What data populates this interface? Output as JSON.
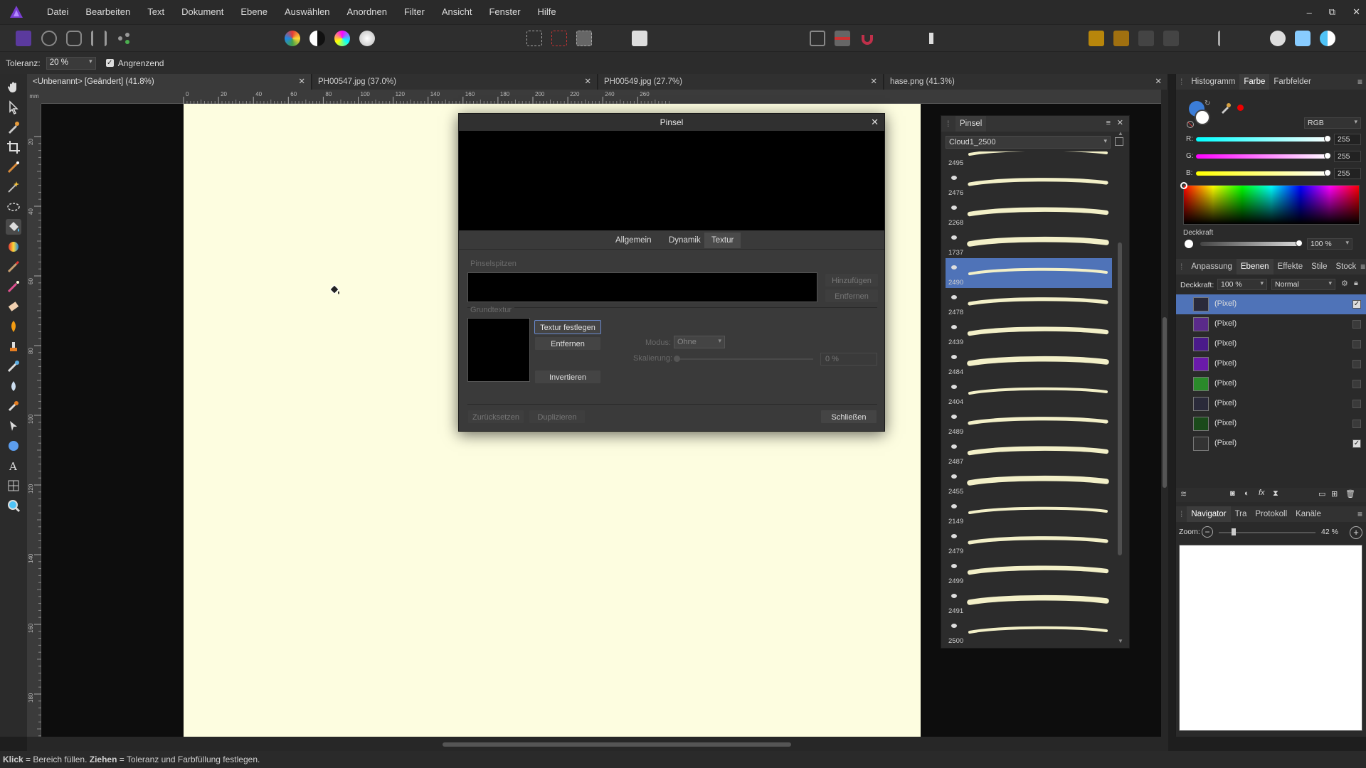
{
  "menubar": {
    "items": [
      "Datei",
      "Bearbeiten",
      "Text",
      "Dokument",
      "Ebene",
      "Auswählen",
      "Anordnen",
      "Filter",
      "Ansicht",
      "Fenster",
      "Hilfe"
    ]
  },
  "window_controls": {
    "minimize": "–",
    "restore": "⧉",
    "close": "✕"
  },
  "context_bar": {
    "tolerance_label": "Toleranz:",
    "tolerance_value": "20 %",
    "contiguous_label": "Angrenzend",
    "contiguous_checked": true
  },
  "document_tabs": [
    {
      "label": "<Unbenannt> [Geändert] (41.8%)",
      "active": true
    },
    {
      "label": "PH00547.jpg (37.0%)",
      "active": false
    },
    {
      "label": "PH00549.jpg (27.7%)",
      "active": false
    },
    {
      "label": "hase.png (41.3%)",
      "active": false
    }
  ],
  "ruler": {
    "unit": "mm",
    "h_ticks": [
      "0",
      "20",
      "40",
      "60",
      "80",
      "100",
      "120",
      "140",
      "160",
      "180",
      "200",
      "220",
      "240",
      "260"
    ],
    "v_ticks": [
      "20",
      "40",
      "60",
      "80",
      "100",
      "120",
      "140",
      "160",
      "180"
    ]
  },
  "dialog": {
    "title": "Pinsel",
    "tabs": [
      "Allgemein",
      "Dynamik",
      "Textur"
    ],
    "active_tab": "Textur",
    "section1_label": "Pinselspitzen",
    "section2_label": "Grundtextur",
    "btn_add": "Hinzufügen",
    "btn_remove_tip": "Entfernen",
    "btn_set_texture": "Textur festlegen",
    "btn_remove_texture": "Entfernen",
    "btn_invert": "Invertieren",
    "mode_label": "Modus:",
    "mode_value": "Ohne",
    "scale_label": "Skalierung:",
    "scale_value": "0 %",
    "btn_reset": "Zurücksetzen",
    "btn_duplicate": "Duplizieren",
    "btn_close": "Schließen"
  },
  "brush_panel": {
    "title": "Pinsel",
    "category": "Cloud1_2500",
    "brushes": [
      "2495",
      "2476",
      "2268",
      "1737",
      "2490",
      "2478",
      "2439",
      "2484",
      "2404",
      "2489",
      "2487",
      "2455",
      "2149",
      "2479",
      "2499",
      "2491",
      "2500"
    ],
    "selected": "2490"
  },
  "color_panel": {
    "tabs": [
      "Histogramm",
      "Farbe",
      "Farbfelder"
    ],
    "active_tab": "Farbe",
    "mode": "RGB",
    "r_label": "R:",
    "r_value": "255",
    "g_label": "G:",
    "g_value": "255",
    "b_label": "B:",
    "b_value": "255",
    "opacity_label": "Deckkraft",
    "opacity_value": "100 %"
  },
  "layers_panel": {
    "tabs": [
      "Anpassung",
      "Ebenen",
      "Effekte",
      "Stile",
      "Stock"
    ],
    "active_tab": "Ebenen",
    "opacity_label": "Deckkraft:",
    "opacity_value": "100 %",
    "blend_mode": "Normal",
    "layers": [
      {
        "name": "(Pixel)",
        "selected": true,
        "checked": true,
        "thumb": "#2a2a3a"
      },
      {
        "name": "(Pixel)",
        "selected": false,
        "checked": false,
        "thumb": "#5a2a8a"
      },
      {
        "name": "(Pixel)",
        "selected": false,
        "checked": false,
        "thumb": "#4a1a8a"
      },
      {
        "name": "(Pixel)",
        "selected": false,
        "checked": false,
        "thumb": "#6a1aaa"
      },
      {
        "name": "(Pixel)",
        "selected": false,
        "checked": false,
        "thumb": "#2a8a2a"
      },
      {
        "name": "(Pixel)",
        "selected": false,
        "checked": false,
        "thumb": "#2a2a3a"
      },
      {
        "name": "(Pixel)",
        "selected": false,
        "checked": false,
        "thumb": "#1a4a1a"
      },
      {
        "name": "(Pixel)",
        "selected": false,
        "checked": true,
        "thumb": "#333"
      }
    ]
  },
  "navigator_panel": {
    "tabs": [
      "Navigator",
      "Tra",
      "Protokoll",
      "Kanäle"
    ],
    "active_tab": "Navigator",
    "zoom_label": "Zoom:",
    "zoom_value": "42 %"
  },
  "status": {
    "click_key": "Klick",
    "click_text": " = Bereich füllen. ",
    "drag_key": "Ziehen",
    "drag_text": " = Toleranz und Farbfüllung festlegen."
  }
}
